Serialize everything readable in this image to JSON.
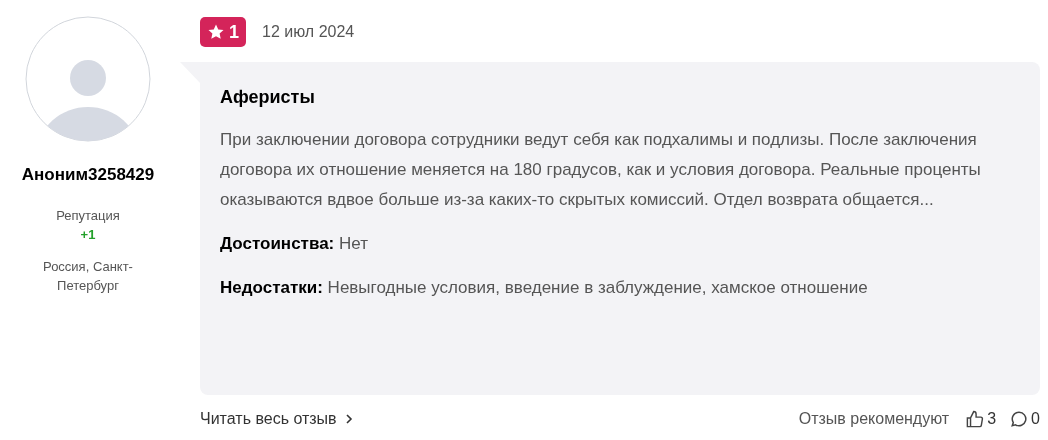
{
  "author": {
    "name": "Аноним3258429",
    "reputation_label": "Репутация",
    "reputation": "+1",
    "location": "Россия, Санкт-Петербург"
  },
  "review": {
    "rating": "1",
    "date": "12 июл 2024",
    "title": "Аферисты",
    "text": "При заключении договора сотрудники ведут себя как подхалимы и подлизы. После заключения договора их отношение меняется на 180 градусов, как и условия договора. Реальные проценты оказываются вдвое больше из-за каких-то скрытых комиссий. Отдел возврата общается...",
    "sections": [
      {
        "label": "Достоинства:",
        "value": "Нет"
      },
      {
        "label": "Недостатки:",
        "value": "Невыгодные условия, введение в заблуждение, хамское отношение"
      }
    ]
  },
  "footer": {
    "read_more": "Читать весь отзыв",
    "recommend_label": "Отзыв рекомендуют",
    "likes": "3",
    "comments": "0"
  }
}
